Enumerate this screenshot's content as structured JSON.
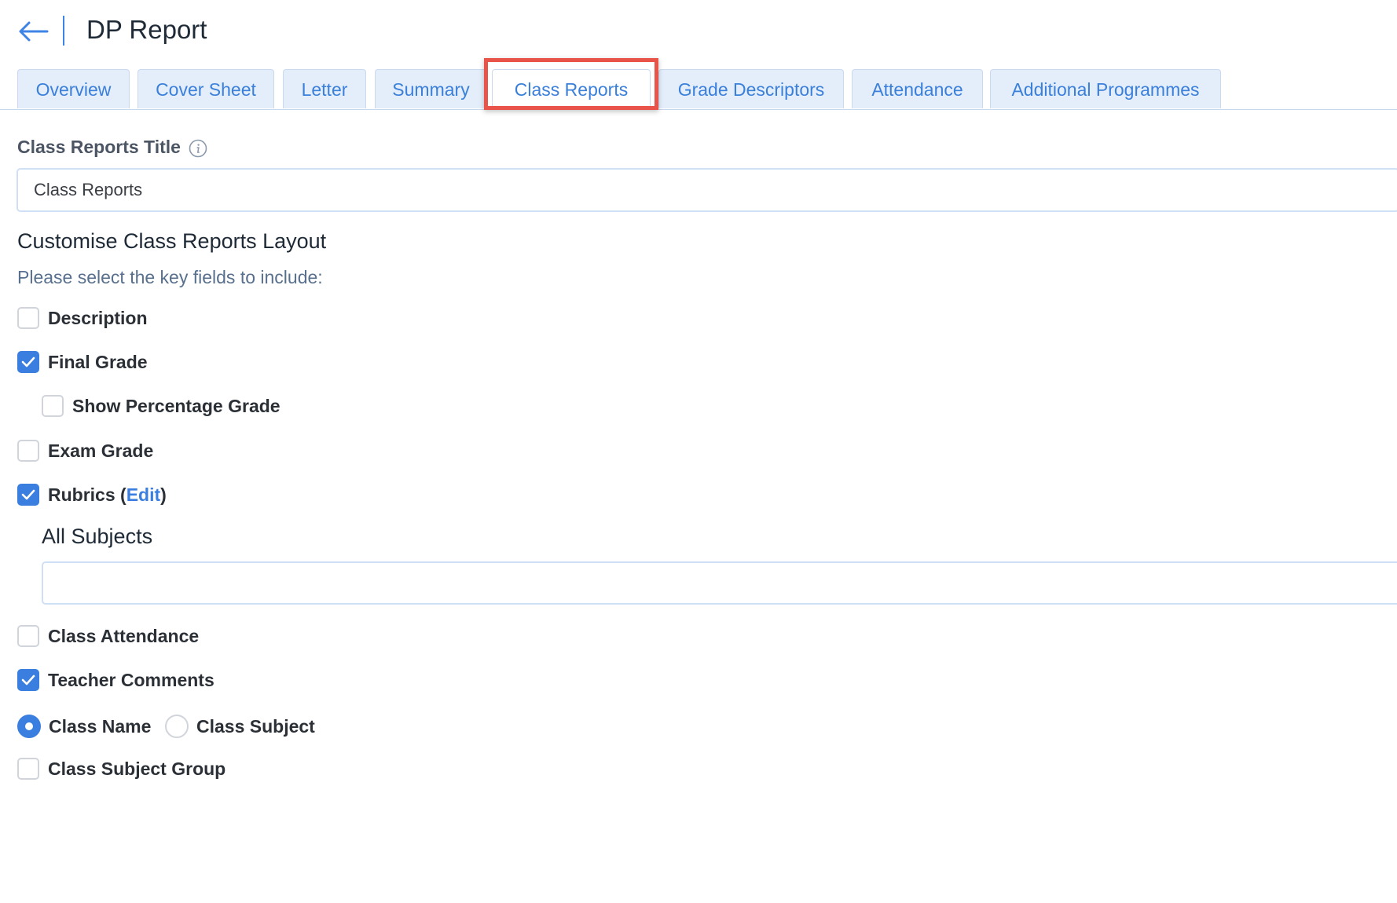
{
  "header": {
    "title": "DP Report"
  },
  "tabs": [
    {
      "label": "Overview"
    },
    {
      "label": "Cover Sheet"
    },
    {
      "label": "Letter"
    },
    {
      "label": "Summary"
    },
    {
      "label": "Class Reports",
      "active": true
    },
    {
      "label": "Grade Descriptors"
    },
    {
      "label": "Attendance"
    },
    {
      "label": "Additional Programmes"
    }
  ],
  "form": {
    "title_label": "Class Reports Title",
    "title_value": "Class Reports",
    "section_title": "Customise Class Reports Layout",
    "section_subtitle": "Please select the key fields to include:",
    "options": {
      "description": {
        "label": "Description",
        "checked": false
      },
      "final_grade": {
        "label": "Final Grade",
        "checked": true
      },
      "show_percentage": {
        "label": "Show Percentage Grade",
        "checked": false
      },
      "exam_grade": {
        "label": "Exam Grade",
        "checked": false
      },
      "rubrics": {
        "label": "Rubrics (",
        "edit": "Edit",
        "close": ")",
        "checked": true
      },
      "class_attendance": {
        "label": "Class Attendance",
        "checked": false
      },
      "teacher_comments": {
        "label": "Teacher Comments",
        "checked": true
      },
      "class_subject_group": {
        "label": "Class Subject Group",
        "checked": false
      }
    },
    "all_subjects_label": "All Subjects",
    "name_choice": {
      "class_name": {
        "label": "Class Name",
        "selected": true
      },
      "class_subject": {
        "label": "Class Subject",
        "selected": false
      }
    }
  },
  "colors": {
    "accent": "#3a7ee0",
    "highlight": "#e8534a",
    "tab_bg": "#e4eefb"
  }
}
